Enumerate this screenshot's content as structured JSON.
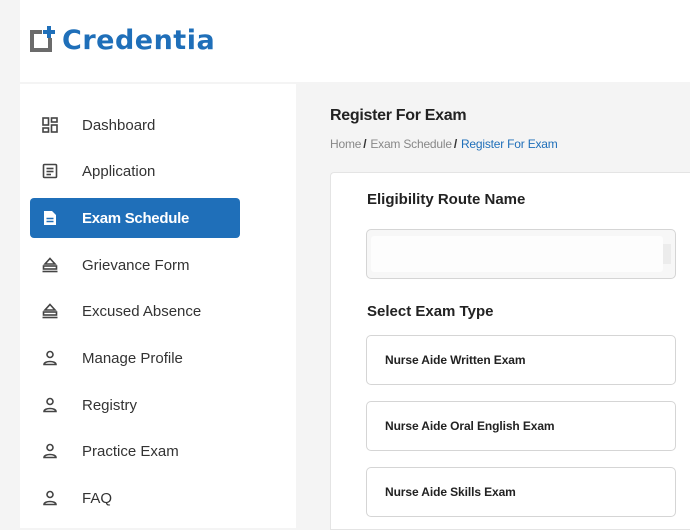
{
  "brand": {
    "name": "Credentia",
    "color": "#1f6fb9"
  },
  "sidebar": {
    "items": [
      {
        "label": "Dashboard",
        "icon": "dashboard-icon",
        "active": false
      },
      {
        "label": "Application",
        "icon": "document-list-icon",
        "active": false
      },
      {
        "label": "Exam Schedule",
        "icon": "file-icon",
        "active": true
      },
      {
        "label": "Grievance Form",
        "icon": "stamp-icon",
        "active": false
      },
      {
        "label": "Excused Absence",
        "icon": "stamp-icon",
        "active": false
      },
      {
        "label": "Manage Profile",
        "icon": "person-icon",
        "active": false
      },
      {
        "label": "Registry",
        "icon": "person-icon",
        "active": false
      },
      {
        "label": "Practice Exam",
        "icon": "person-icon",
        "active": false
      },
      {
        "label": "FAQ",
        "icon": "person-icon",
        "active": false
      }
    ]
  },
  "main": {
    "title": "Register For Exam",
    "breadcrumb": {
      "home": "Home",
      "parent": "Exam Schedule",
      "current": "Register For Exam",
      "separator": "/"
    },
    "eligibility": {
      "label": "Eligibility Route Name",
      "value": ""
    },
    "exam_type": {
      "label": "Select Exam Type",
      "options": [
        "Nurse Aide Written Exam",
        "Nurse Aide Oral English Exam",
        "Nurse Aide Skills Exam"
      ]
    }
  }
}
